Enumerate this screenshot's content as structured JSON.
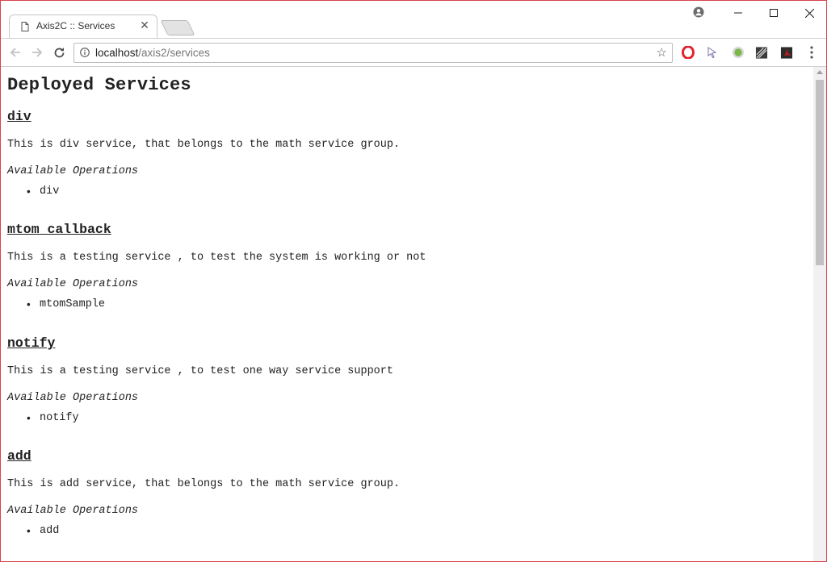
{
  "browser": {
    "tab_title": "Axis2C :: Services",
    "tab_close": "✕",
    "url_host": "localhost",
    "url_path": "/axis2/services",
    "star": "☆",
    "window_controls": {
      "minimize": "—",
      "maximize": "☐",
      "close": "✕"
    }
  },
  "page": {
    "title": "Deployed Services",
    "ops_label": "Available Operations",
    "services": [
      {
        "name": "div",
        "description": "This is div service, that belongs to the math service group.",
        "operations": [
          "div"
        ]
      },
      {
        "name": "mtom_callback",
        "description": "This is a testing service , to test the system is working or not",
        "operations": [
          "mtomSample"
        ]
      },
      {
        "name": "notify",
        "description": "This is a testing service , to test one way service support",
        "operations": [
          "notify"
        ]
      },
      {
        "name": "add",
        "description": "This is add service, that belongs to the math service group.",
        "operations": [
          "add"
        ]
      }
    ]
  },
  "icons": {
    "tab": "page-icon",
    "back": "back-arrow-icon",
    "forward": "forward-arrow-icon",
    "reload": "reload-icon",
    "info": "info-icon",
    "colors": {
      "opera": "#e3232d",
      "green_ext": "#7ab648",
      "pdf": "#c11a1a",
      "frame_border": "#d9434c"
    }
  }
}
